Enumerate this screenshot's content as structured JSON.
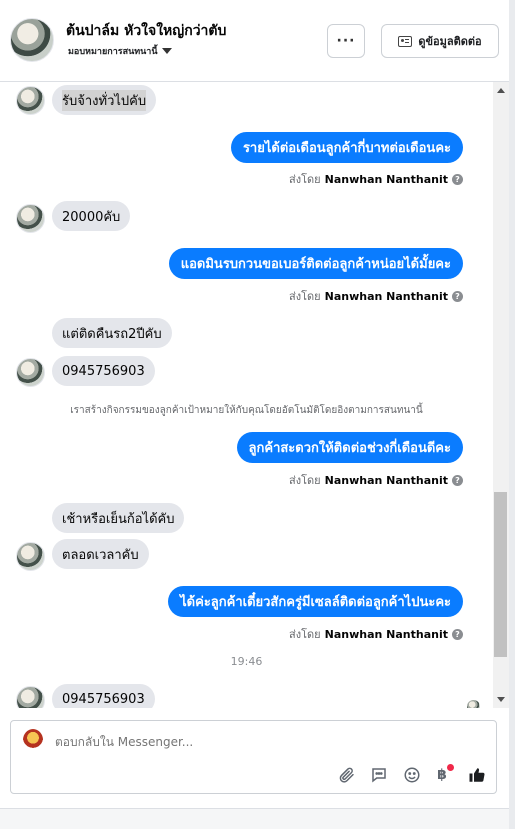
{
  "header": {
    "title": "ต้นปาล์ม หัวใจใหญ่กว่าตับ",
    "subtitle": "มอบหมายการสนทนานี้",
    "more_label": "···",
    "contact_label": "ดูข้อมูลติดต่อ"
  },
  "messages": [
    {
      "text": "รับจ้างทั่วไปคับ"
    },
    {
      "text": "รายได้ต่อเดือนลูกค้ากี่บาทต่อเดือนคะ",
      "sent_by_prefix": "ส่งโดย",
      "sender": "Nanwhan Nanthanit"
    },
    {
      "text": "20000คับ"
    },
    {
      "text": "แอดมินรบกวนขอเบอร์ติดต่อลูกค้าหน่อยได้มั้ยคะ",
      "sent_by_prefix": "ส่งโดย",
      "sender": "Nanwhan Nanthanit"
    },
    {
      "text": "แต่ติดคืนรถ2ปีคับ"
    },
    {
      "text": "0945756903"
    },
    {
      "text": "เราสร้างกิจกรรมของลูกค้าเป้าหมายให้กับคุณโดยอัตโนมัติโดยอิงตามการสนทนานี้"
    },
    {
      "text": "ลูกค้าสะดวกให้ติดต่อช่วงกี่เดือนดีคะ",
      "sent_by_prefix": "ส่งโดย",
      "sender": "Nanwhan Nanthanit"
    },
    {
      "text": "เช้าหรือเย็นก้อได้คับ"
    },
    {
      "text": "ตลอดเวลาคับ"
    },
    {
      "text": "ได้ค่ะลูกค้าเดี๋ยวสักครู่มีเซลล์ติดต่อลูกค้าไปนะคะ",
      "sent_by_prefix": "ส่งโดย",
      "sender": "Nanwhan Nanthanit"
    },
    {
      "text": "19:46"
    },
    {
      "text": "0945756903"
    }
  ],
  "info_glyph": "?",
  "composer": {
    "placeholder": "ตอบกลับใน Messenger...",
    "icons": [
      "paperclip-icon",
      "chat-bubble-icon",
      "emoji-icon",
      "baht-icon",
      "thumbs-up-icon"
    ]
  },
  "colors": {
    "outgoing_bubble": "#0a7cff",
    "incoming_bubble": "#e4e6eb",
    "notification_dot": "#f02849"
  }
}
